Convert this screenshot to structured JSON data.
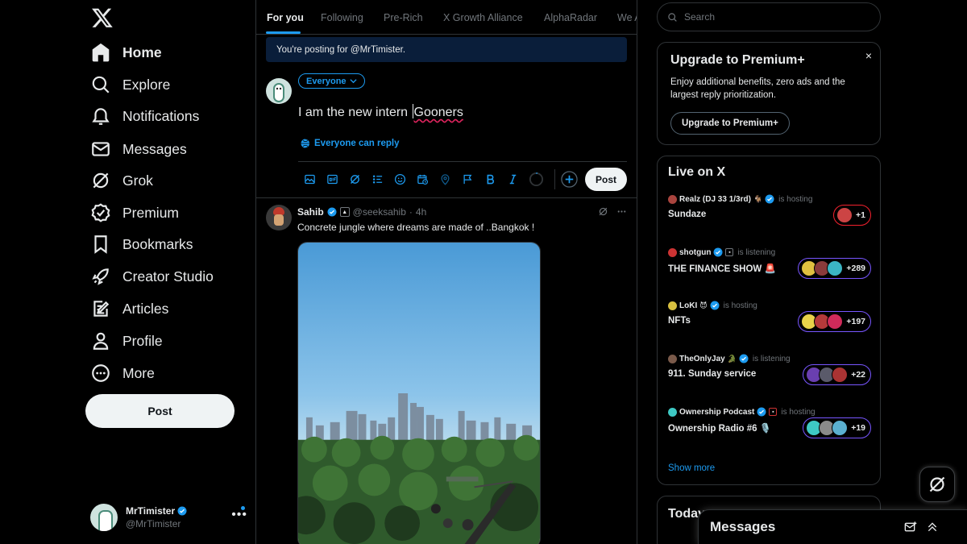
{
  "nav": {
    "items": [
      {
        "label": "Home",
        "icon": "home-icon"
      },
      {
        "label": "Explore",
        "icon": "search-icon"
      },
      {
        "label": "Notifications",
        "icon": "bell-icon"
      },
      {
        "label": "Messages",
        "icon": "mail-icon"
      },
      {
        "label": "Grok",
        "icon": "grok-icon"
      },
      {
        "label": "Premium",
        "icon": "premium-icon"
      },
      {
        "label": "Bookmarks",
        "icon": "bookmark-icon"
      },
      {
        "label": "Creator Studio",
        "icon": "rocket-icon"
      },
      {
        "label": "Articles",
        "icon": "article-icon"
      },
      {
        "label": "Profile",
        "icon": "person-icon"
      },
      {
        "label": "More",
        "icon": "more-circle-icon"
      }
    ],
    "post_label": "Post"
  },
  "account": {
    "name": "MrTimister",
    "handle": "@MrTimister"
  },
  "tabs": [
    "For you",
    "Following",
    "Pre-Rich",
    "X Growth Alliance",
    "AlphaRadar",
    "We A"
  ],
  "composer": {
    "posting_banner": "You're posting for @MrTimister.",
    "audience": "Everyone",
    "text_before": "I am the new intern ",
    "text_misspelled": "Gooners",
    "reply_setting": "Everyone can reply",
    "post_label": "Post"
  },
  "tweet": {
    "name": "Sahib",
    "handle": "@seeksahib",
    "separator": "·",
    "time": "4h",
    "text": "Concrete jungle where dreams are made of ..Bangkok !"
  },
  "search": {
    "placeholder": "Search"
  },
  "premium": {
    "title": "Upgrade to Premium+",
    "close": "×",
    "description": "Enjoy additional benefits, zero ads and the largest reply prioritization.",
    "button": "Upgrade to Premium+"
  },
  "live": {
    "title": "Live on X",
    "items": [
      {
        "host": "Realz (DJ 33 1/3rd)",
        "emoji": "🐐",
        "status": "is hosting",
        "name": "Sundaze",
        "count": "+1"
      },
      {
        "host": "shotgun",
        "emoji": "",
        "status": "is listening",
        "name": "THE FINANCE SHOW 🚨",
        "count": "+289"
      },
      {
        "host": "LoKI",
        "emoji": "😈",
        "status": "is hosting",
        "name": "NFTs",
        "count": "+197"
      },
      {
        "host": "TheOnlyJay",
        "emoji": "🐊",
        "status": "is listening",
        "name": "911. Sunday service",
        "count": "+22"
      },
      {
        "host": "Ownership Podcast",
        "emoji": "",
        "status": "is hosting",
        "name": "Ownership Radio #6 🎙️",
        "count": "+19"
      }
    ],
    "show_more": "Show more"
  },
  "today": {
    "title": "Today"
  },
  "messages_drawer": {
    "title": "Messages"
  },
  "colors": {
    "accent": "#1d9bf0",
    "background": "#000000",
    "border": "#2f3336",
    "muted": "#71767b",
    "live_purple": "#7856ff",
    "live_red": "#f4212e"
  }
}
